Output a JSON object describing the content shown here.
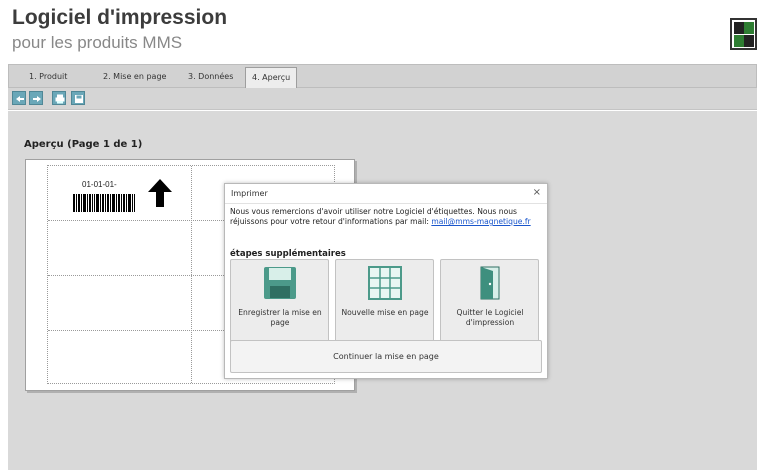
{
  "header": {
    "title": "Logiciel d'impression",
    "subtitle": "pour les produits MMS"
  },
  "tabs": [
    {
      "label": "1. Produit"
    },
    {
      "label": "2. Mise en page"
    },
    {
      "label": "3. Données"
    },
    {
      "label": "4. Aperçu",
      "active": true
    }
  ],
  "toolbar": {
    "buttons": [
      "arrow-left-icon",
      "arrow-right-icon",
      "print-icon",
      "save-icon"
    ]
  },
  "preview": {
    "title": "Aperçu (Page 1 de 1)",
    "label_text": "01-01-01-"
  },
  "dialog": {
    "title": "Imprimer",
    "close": "×",
    "message": "Nous vous remercions d'avoir utiliser notre Logiciel d'étiquettes. Nous nous réjuissons pour votre retour d'informations par mail:",
    "email": "mail@mms-magnetique.fr",
    "subheading": "étapes supplémentaires",
    "options": [
      {
        "label": "Enregistrer la mise en page",
        "icon": "floppy-disk-icon"
      },
      {
        "label": "Nouvelle mise en page",
        "icon": "grid-layout-icon"
      },
      {
        "label": "Quitter le Logiciel d'impression",
        "icon": "exit-door-icon"
      }
    ],
    "continue_label": "Continuer la mise en page"
  },
  "colors": {
    "accent": "#4c9a8a",
    "toolbar_button": "#6aa7b8",
    "link": "#1a56cc"
  }
}
